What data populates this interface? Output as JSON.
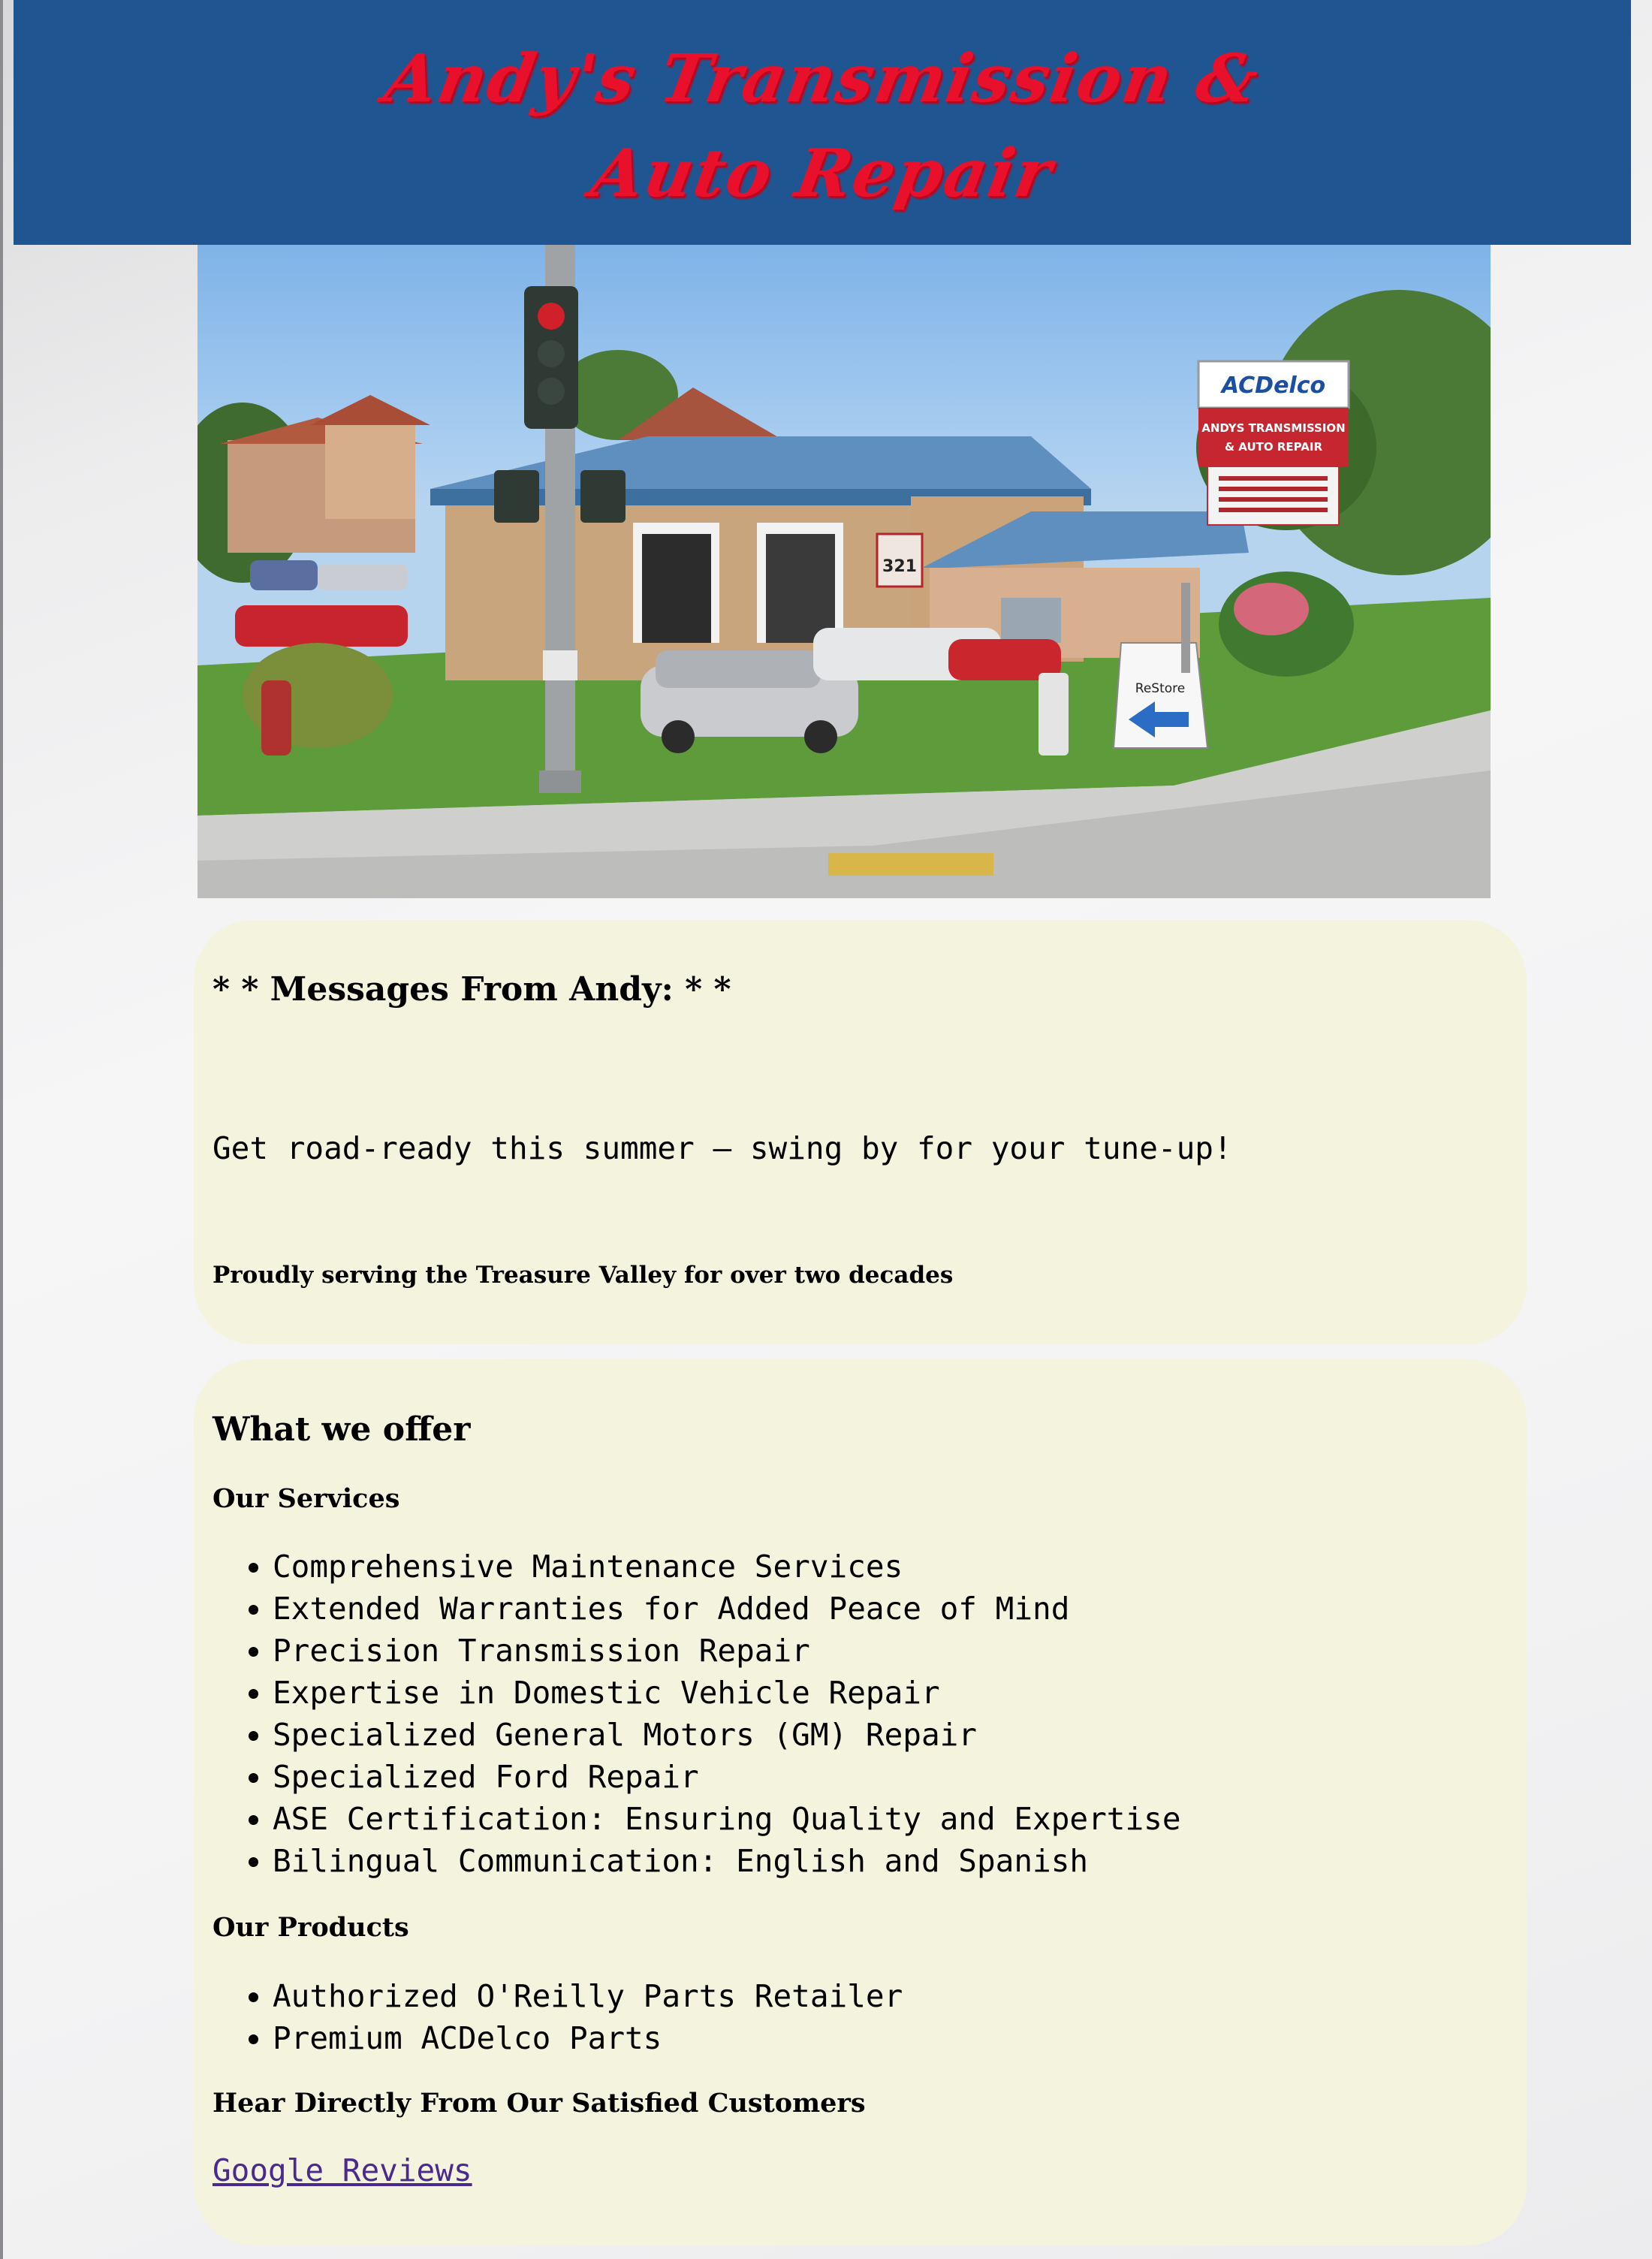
{
  "header": {
    "title_line1": "Andy's Transmission &",
    "title_line2": "Auto Repair"
  },
  "hero": {
    "sign_brand": "ACDelco",
    "sign_name_line1": "ANDYS TRANSMISSION",
    "sign_name_line2": "& AUTO REPAIR",
    "address_number": "321",
    "restore_sign": "ReStore"
  },
  "messages": {
    "heading": "* * Messages From Andy: * *",
    "body": "Get road-ready this summer – swing by for your tune-up!",
    "tagline": "Proudly serving the Treasure Valley for over two decades"
  },
  "offer": {
    "heading": "What we offer",
    "services_heading": "Our Services",
    "services": [
      "Comprehensive Maintenance Services",
      "Extended Warranties for Added Peace of Mind",
      "Precision Transmission Repair",
      "Expertise in Domestic Vehicle Repair",
      "Specialized General Motors (GM) Repair",
      "Specialized Ford Repair",
      "ASE Certification: Ensuring Quality and Expertise",
      "Bilingual Communication: English and Spanish"
    ],
    "products_heading": "Our Products",
    "products": [
      "Authorized O'Reilly Parts Retailer",
      "Premium ACDelco Parts"
    ],
    "reviews_heading": "Hear Directly From Our Satisfied Customers",
    "reviews_link": "Google Reviews"
  }
}
